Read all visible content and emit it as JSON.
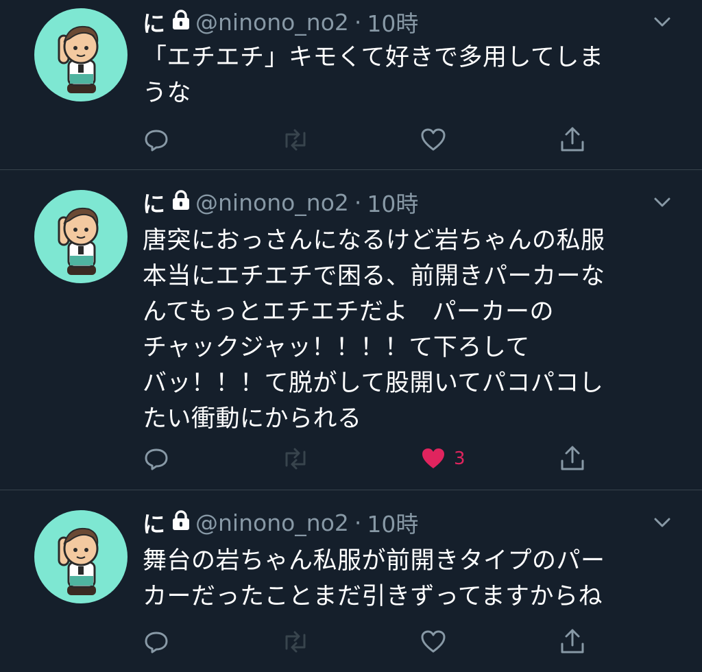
{
  "tweets": [
    {
      "name": "に",
      "handle": "@ninono_no2",
      "separator": "·",
      "time": "10時",
      "text": "「エチエチ」キモくて好きで多用してしま\nうな",
      "like_count": ""
    },
    {
      "name": "に",
      "handle": "@ninono_no2",
      "separator": "·",
      "time": "10時",
      "text": "唐突におっさんになるけど岩ちゃんの私服\n本当にエチエチで困る、前開きパーカーな\nんてもっとエチエチだよ　パーカーの\nチャックジャッ！！！！て下ろして\nバッ！！！て脱がして股開いてパコパコし\nたい衝動にかられる",
      "like_count": "3"
    },
    {
      "name": "に",
      "handle": "@ninono_no2",
      "separator": "·",
      "time": "10時",
      "text": "舞台の岩ちゃん私服が前開きタイプのパー\nカーだったことまだ引きずってますからね",
      "like_count": ""
    }
  ],
  "icons": {
    "lock": "lock-icon",
    "chevron": "chevron-down-icon",
    "reply": "reply-icon",
    "retweet": "retweet-icon",
    "like": "heart-icon",
    "share": "share-icon"
  },
  "colors": {
    "background": "#151f2b",
    "text": "#ffffff",
    "secondary": "#8899a6",
    "like_active": "#e0245e",
    "avatar_bg": "#7ee7d2",
    "divider": "#38444d"
  }
}
